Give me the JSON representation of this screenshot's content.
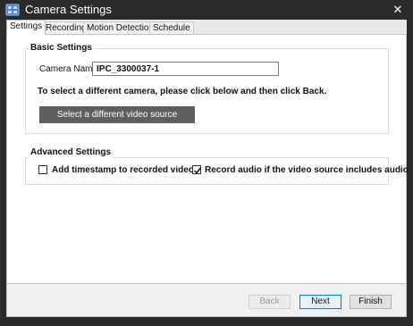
{
  "window": {
    "title": "Camera Settings",
    "close_symbol": "✕"
  },
  "tabs": [
    {
      "label": "Settings",
      "active": true
    },
    {
      "label": "Recording",
      "active": false
    },
    {
      "label": "Motion Detection",
      "active": false
    },
    {
      "label": "Schedule",
      "active": false
    }
  ],
  "basic_settings": {
    "title": "Basic Settings",
    "camera_name_label": "Camera Name:",
    "camera_name_value": "IPC_3300037-1",
    "instruction": "To select a different camera, please click below and then click Back.",
    "select_source_button": "Select a different video source"
  },
  "advanced_settings": {
    "title": "Advanced Settings",
    "timestamp_label": "Add timestamp to recorded video",
    "timestamp_checked": false,
    "audio_label": "Record audio if the video source includes audio",
    "audio_checked": true
  },
  "footer": {
    "back_label": "Back",
    "back_enabled": false,
    "next_label": "Next",
    "finish_label": "Finish"
  },
  "icons": {
    "app": "camera-settings-icon",
    "close": "close-icon",
    "check": "checkmark-icon"
  },
  "colors": {
    "titlebar": "#2b2b2b",
    "dark_button": "#5f5f5f",
    "focus_border": "#0078d7"
  }
}
